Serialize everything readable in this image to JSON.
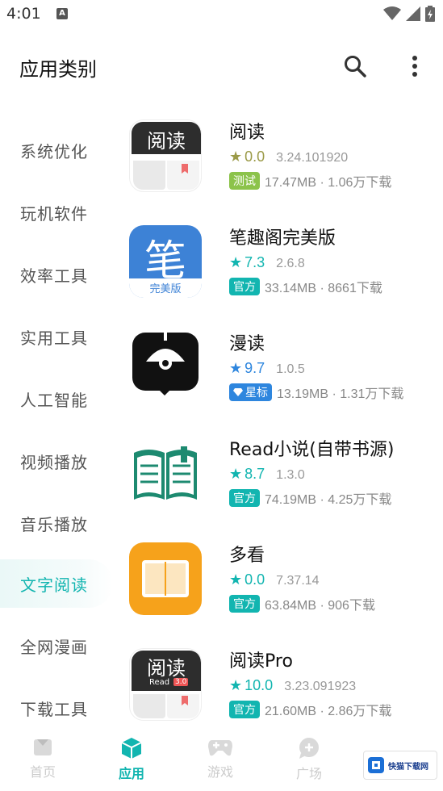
{
  "status_bar": {
    "time": "4:01",
    "a_badge": "A"
  },
  "app_bar": {
    "title": "应用类别",
    "search_icon": "search-icon",
    "more_icon": "more-vertical-icon"
  },
  "sidebar": {
    "items": [
      {
        "label": "系统优化"
      },
      {
        "label": "玩机软件"
      },
      {
        "label": "效率工具"
      },
      {
        "label": "实用工具"
      },
      {
        "label": "人工智能"
      },
      {
        "label": "视频播放"
      },
      {
        "label": "音乐播放"
      },
      {
        "label": "文字阅读"
      },
      {
        "label": "全网漫画"
      },
      {
        "label": "下载工具"
      }
    ],
    "active_label": "文字阅读"
  },
  "apps": [
    {
      "name": "阅读",
      "rating": "0.0",
      "version": "3.24.101920",
      "badge": "测试",
      "size_downloads": "17.47MB · 1.06万下载",
      "icon_text": "阅读"
    },
    {
      "name": "笔趣阁完美版",
      "rating": "7.3",
      "version": "2.6.8",
      "badge": "官方",
      "size_downloads": "33.14MB · 8661下载",
      "icon_text": "笔",
      "icon_sub": "完美版"
    },
    {
      "name": "漫读",
      "rating": "9.7",
      "version": "1.0.5",
      "badge": "星标",
      "size_downloads": "13.19MB · 1.31万下载"
    },
    {
      "name": "Read小说(自带书源)",
      "rating": "8.7",
      "version": "1.3.0",
      "badge": "官方",
      "size_downloads": "74.19MB · 4.25万下载"
    },
    {
      "name": "多看",
      "rating": "0.0",
      "version": "7.37.14",
      "badge": "官方",
      "size_downloads": "63.84MB · 906下载"
    },
    {
      "name": "阅读Pro",
      "rating": "10.0",
      "version": "3.23.091923",
      "badge": "官方",
      "size_downloads": "21.60MB · 2.86万下载",
      "icon_text": "阅读",
      "icon_sub": "Read",
      "icon_tag": "3.0"
    }
  ],
  "bottom_nav": [
    {
      "label": "首页",
      "icon": "home-icon"
    },
    {
      "label": "应用",
      "icon": "apps-cube-icon"
    },
    {
      "label": "游戏",
      "icon": "gamepad-icon"
    },
    {
      "label": "广场",
      "icon": "chat-bubble-icon"
    }
  ],
  "watermark": {
    "text": "快猫下载网"
  },
  "colors": {
    "accent": "#12b5b0",
    "test_badge": "#8cc34b",
    "star_badge": "#2e86de",
    "grey_star": "#9b9a48"
  }
}
